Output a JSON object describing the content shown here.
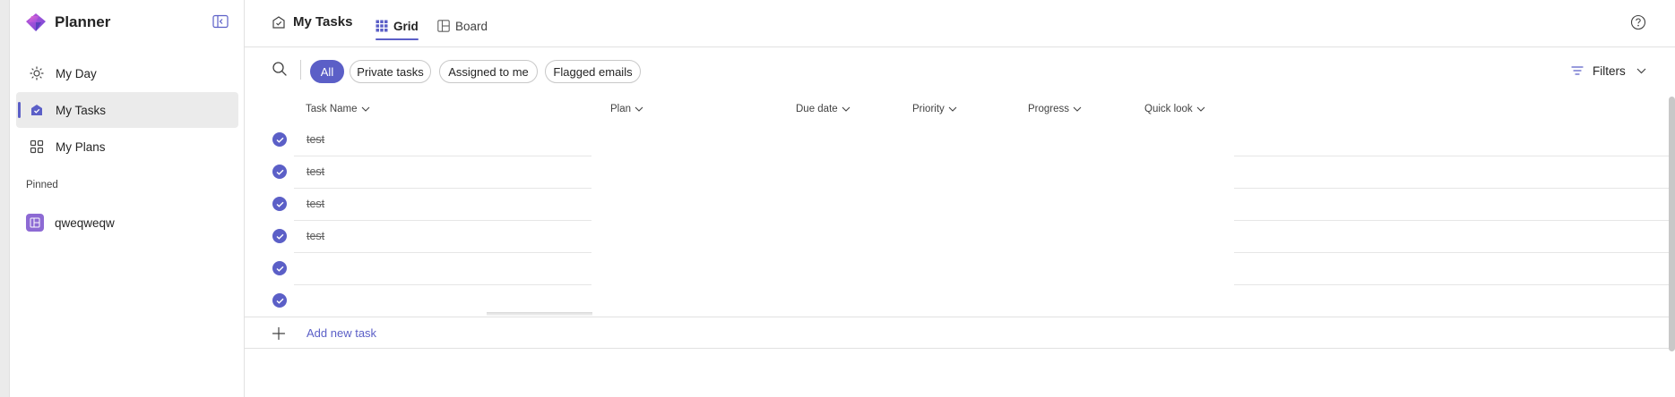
{
  "app": {
    "name": "Planner"
  },
  "sidebar": {
    "items": [
      {
        "label": "My Day",
        "icon": "sun-icon",
        "active": false
      },
      {
        "label": "My Tasks",
        "icon": "tasks-icon",
        "active": true
      },
      {
        "label": "My Plans",
        "icon": "grid-icon",
        "active": false
      }
    ],
    "pinned_header": "Pinned",
    "pinned": [
      {
        "label": "qweqweqw",
        "icon": "plan-icon"
      }
    ]
  },
  "header": {
    "title": "My Tasks",
    "tabs": [
      {
        "label": "Grid",
        "active": true
      },
      {
        "label": "Board",
        "active": false
      }
    ]
  },
  "toolbar": {
    "chips": [
      {
        "label": "All",
        "active": true
      },
      {
        "label": "Private tasks",
        "active": false
      },
      {
        "label": "Assigned to me",
        "active": false
      },
      {
        "label": "Flagged emails",
        "active": false
      }
    ],
    "filters_label": "Filters"
  },
  "grid": {
    "columns": [
      "Task Name",
      "Plan",
      "Due date",
      "Priority",
      "Progress",
      "Quick look"
    ],
    "rows": [
      {
        "name": "test",
        "completed": true
      },
      {
        "name": "test",
        "completed": true
      },
      {
        "name": "test",
        "completed": true
      },
      {
        "name": "test",
        "completed": true
      },
      {
        "name": "",
        "completed": true
      },
      {
        "name": "",
        "completed": true
      }
    ],
    "add_label": "Add new task"
  },
  "colors": {
    "accent": "#5b5fc7",
    "plan_icon": "#8d6ad4"
  }
}
